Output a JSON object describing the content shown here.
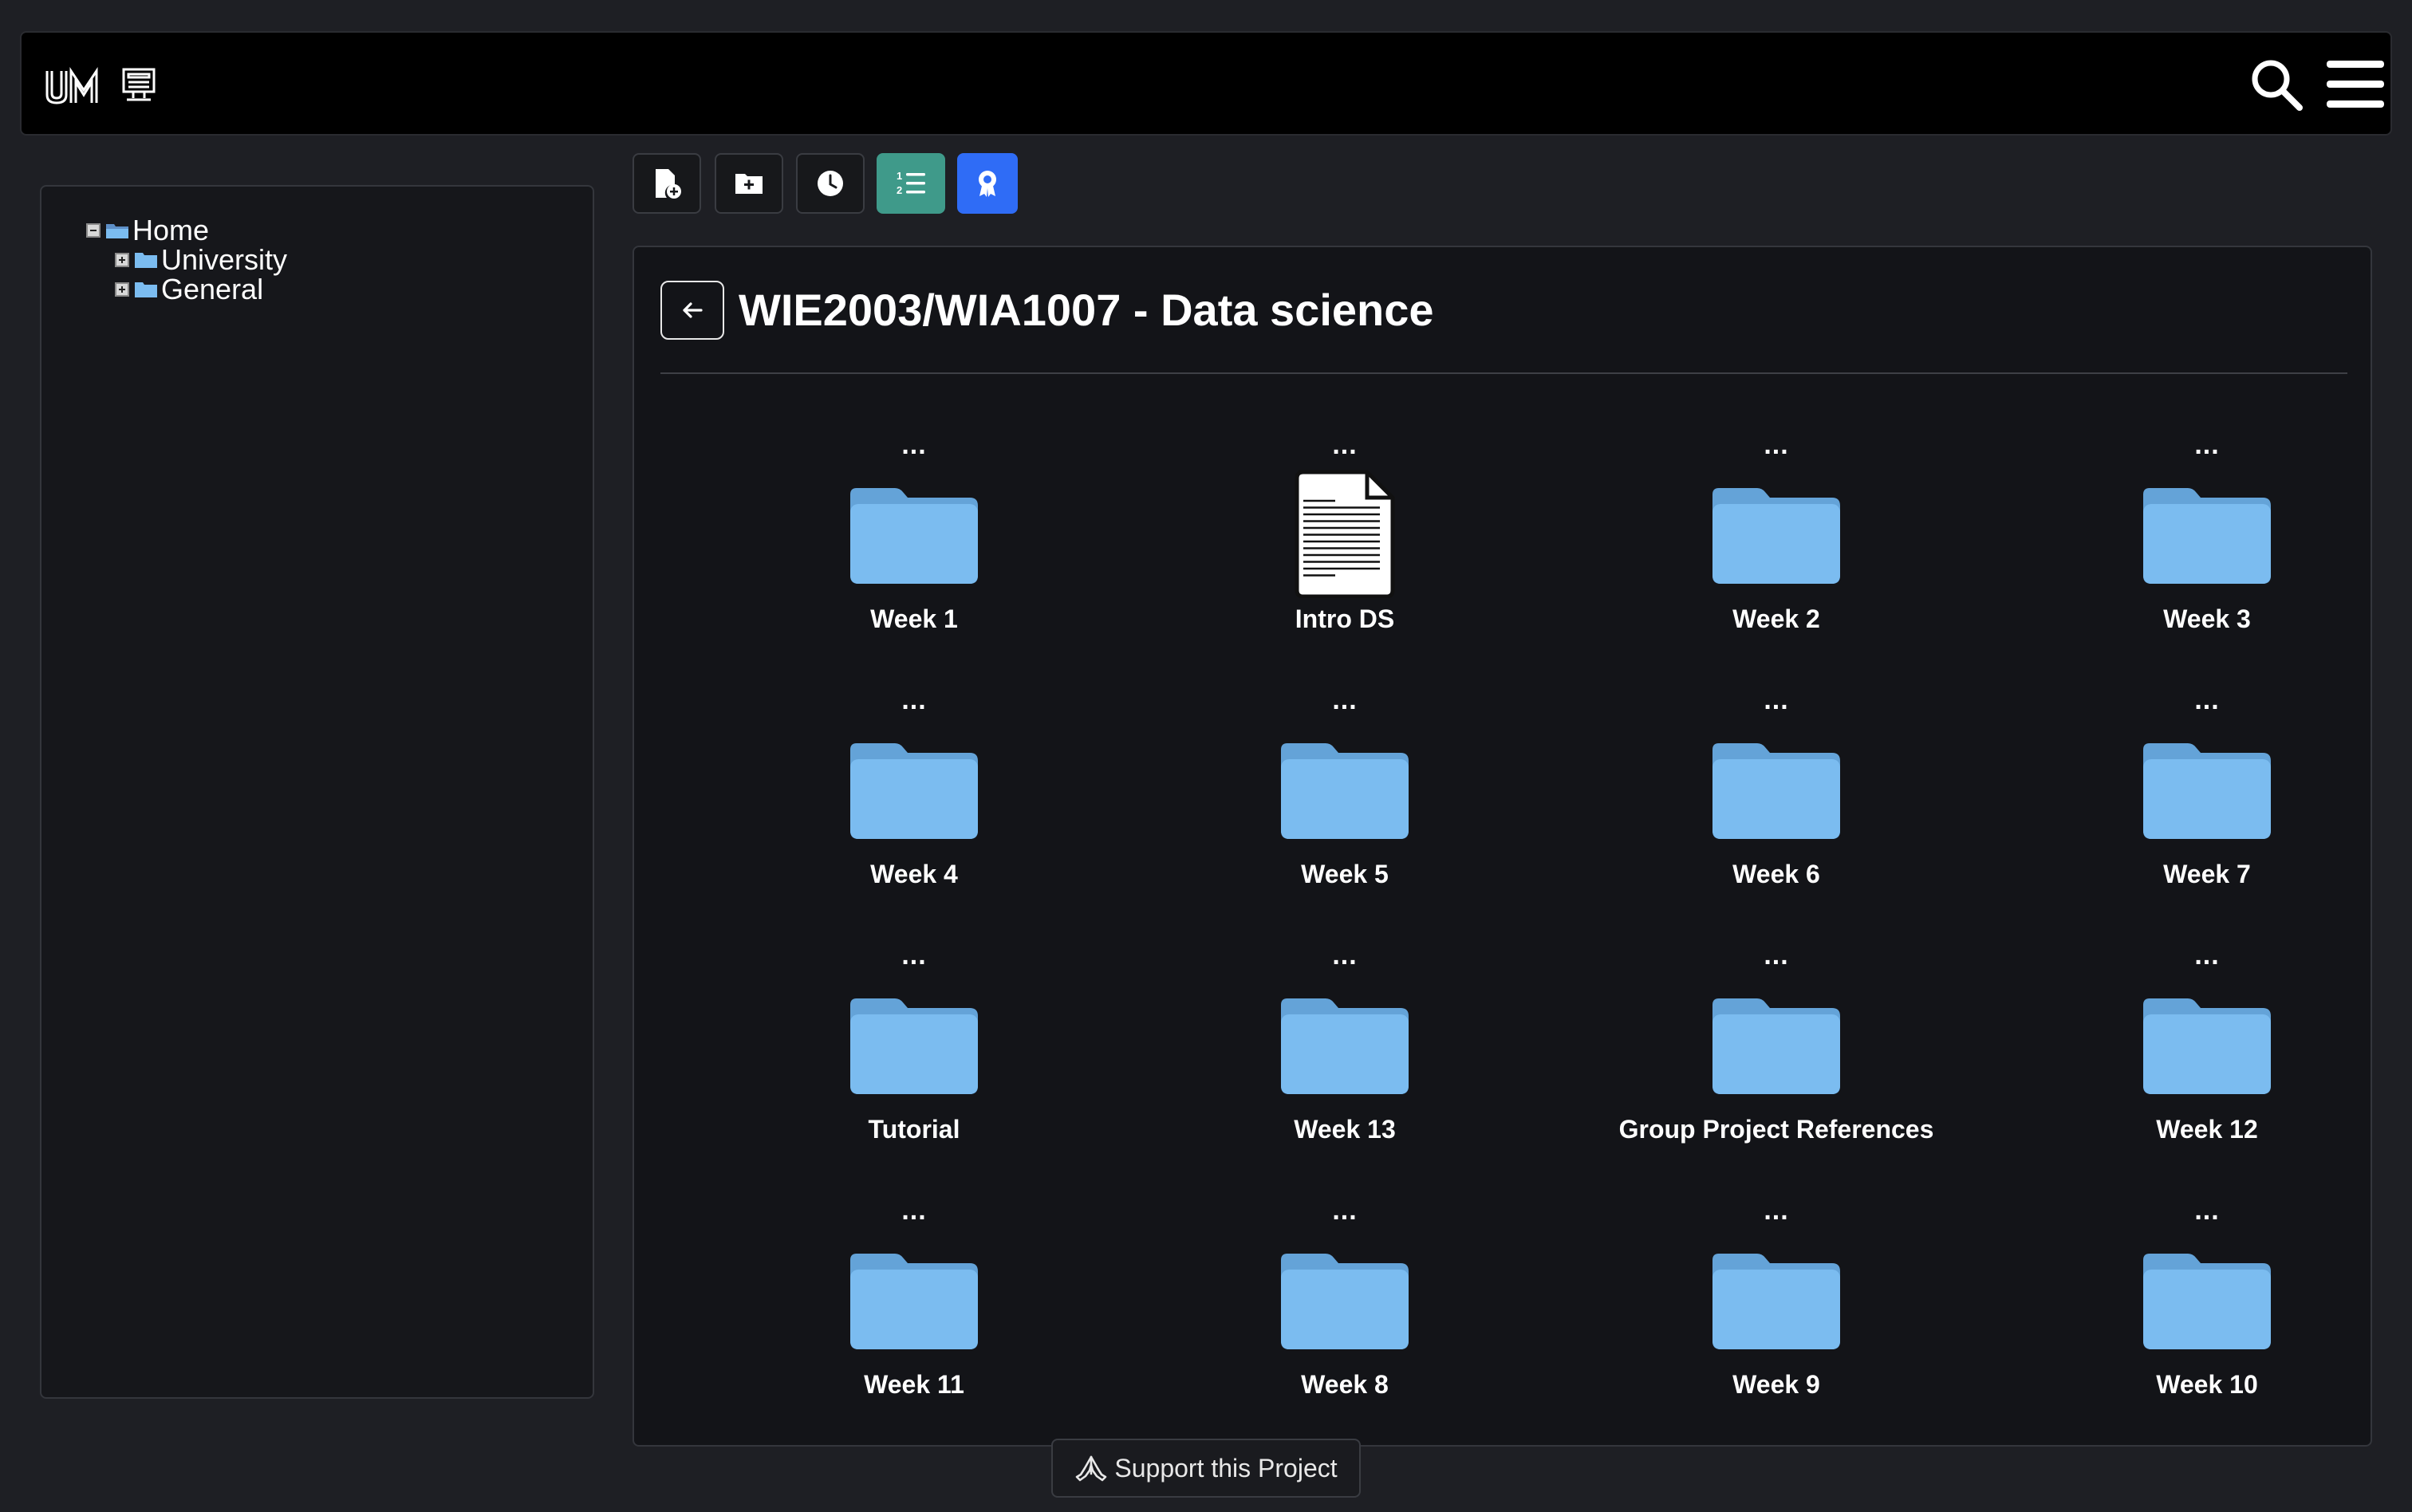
{
  "header": {
    "logo_text": "UM",
    "search_icon": "search-icon",
    "menu_icon": "hamburger-menu-icon"
  },
  "sidebar": {
    "tree": [
      {
        "label": "Home",
        "expanded": true
      },
      {
        "label": "University",
        "expanded": false
      },
      {
        "label": "General",
        "expanded": false
      }
    ]
  },
  "toolbar": {
    "buttons": [
      {
        "icon": "file-add-icon"
      },
      {
        "icon": "folder-add-icon"
      },
      {
        "icon": "clock-icon"
      },
      {
        "icon": "numbered-list-icon",
        "color": "#3f9a8a"
      },
      {
        "icon": "award-icon",
        "color": "#2f6cf6"
      }
    ]
  },
  "main": {
    "title": "WIE2003/WIA1007 - Data science",
    "more_label": "...",
    "items": [
      {
        "label": "Week 1",
        "type": "folder"
      },
      {
        "label": "Intro DS",
        "type": "document"
      },
      {
        "label": "Week 2",
        "type": "folder"
      },
      {
        "label": "Week 3",
        "type": "folder"
      },
      {
        "label": "Week 4",
        "type": "folder"
      },
      {
        "label": "Week 5",
        "type": "folder"
      },
      {
        "label": "Week 6",
        "type": "folder"
      },
      {
        "label": "Week 7",
        "type": "folder"
      },
      {
        "label": "Tutorial",
        "type": "folder"
      },
      {
        "label": "Week 13",
        "type": "folder"
      },
      {
        "label": "Group Project References",
        "type": "folder"
      },
      {
        "label": "Week 12",
        "type": "folder"
      },
      {
        "label": "Week 11",
        "type": "folder"
      },
      {
        "label": "Week 8",
        "type": "folder"
      },
      {
        "label": "Week 9",
        "type": "folder"
      },
      {
        "label": "Week 10",
        "type": "folder"
      }
    ]
  },
  "footer": {
    "support_label": "Support this Project"
  },
  "colors": {
    "folder": "#7bbcf0",
    "folder_tab": "#64a3d8",
    "background": "#1e1f24",
    "panel": "#131418"
  }
}
